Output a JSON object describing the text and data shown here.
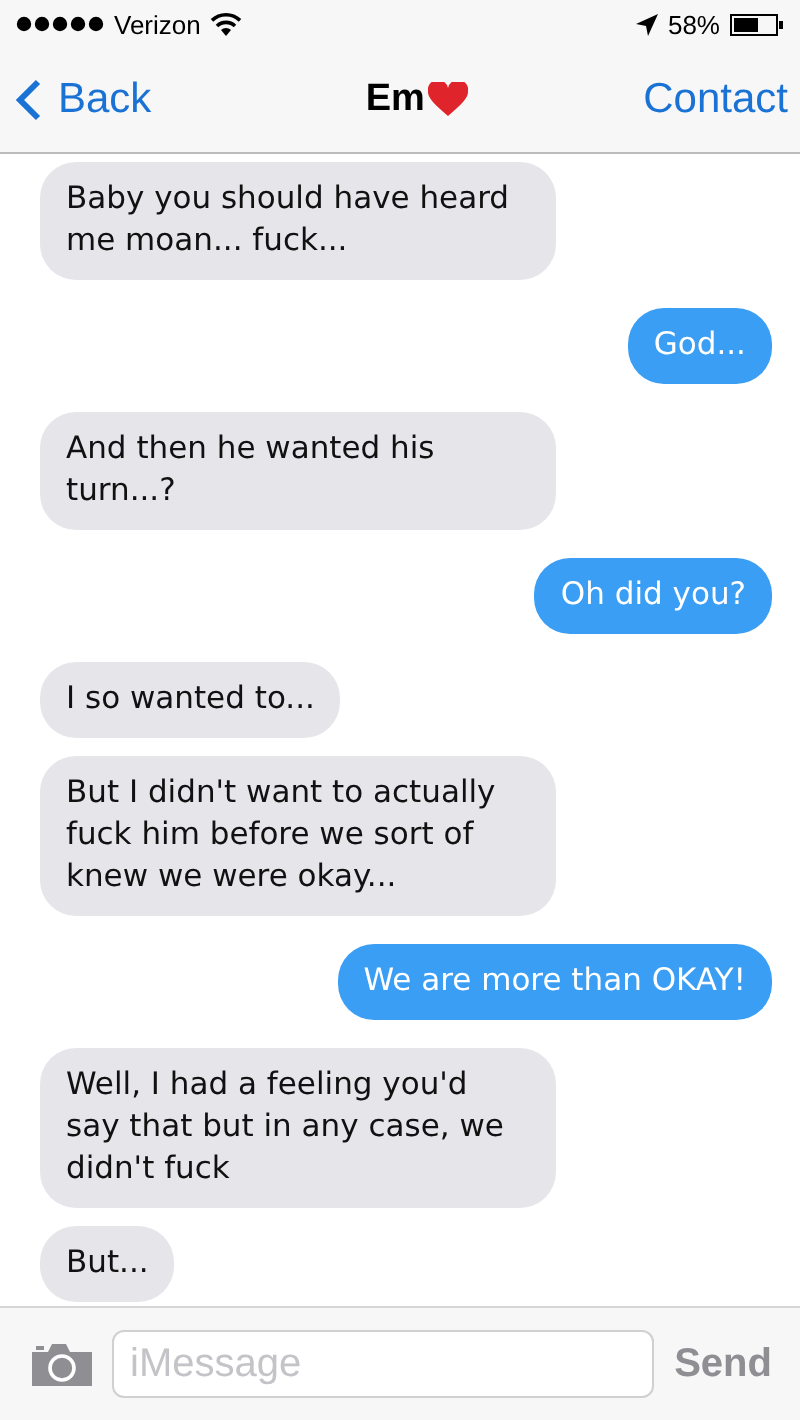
{
  "status_bar": {
    "carrier": "Verizon",
    "battery": "58%"
  },
  "nav": {
    "back": "Back",
    "title": "Em",
    "contact": "Contact"
  },
  "messages": [
    {
      "kind": "received",
      "text": "Baby you should have heard me moan... fuck..."
    },
    {
      "kind": "sent",
      "text": "God..."
    },
    {
      "kind": "received",
      "text": "And then he wanted his turn...?"
    },
    {
      "kind": "sent",
      "text": "Oh did you?"
    },
    {
      "kind": "received",
      "text": "I so wanted to..."
    },
    {
      "kind": "received",
      "text": "But I didn't want to actually fuck him before we sort of knew we were okay..."
    },
    {
      "kind": "sent",
      "text": "We are more than OKAY!"
    },
    {
      "kind": "received",
      "text": "Well, I had a feeling you'd say that but in any case, we didn't fuck"
    },
    {
      "kind": "received",
      "text": "But..."
    }
  ],
  "composer": {
    "placeholder": "iMessage",
    "send": "Send"
  }
}
